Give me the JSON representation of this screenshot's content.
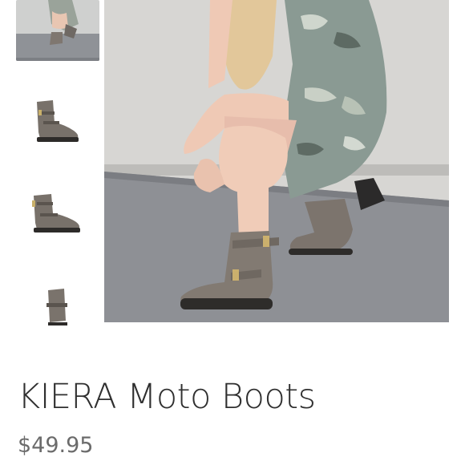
{
  "product": {
    "title": "KIERA Moto Boots",
    "price": "$49.95"
  },
  "gallery": {
    "thumbnails": [
      {
        "icon": "boots-model-photo",
        "selected": true
      },
      {
        "icon": "boot-side-view",
        "selected": false
      },
      {
        "icon": "boot-angled-view",
        "selected": false
      },
      {
        "icon": "boot-back-view",
        "selected": false
      }
    ],
    "main_image": "model-wearing-grey-suede-moto-boots"
  },
  "colors": {
    "boot_grey": "#7d756d",
    "wall_grey": "#d7d6d3",
    "pavement": "#8f9196",
    "title_text": "#2f2f2f",
    "price_text": "#6b6b6b"
  }
}
